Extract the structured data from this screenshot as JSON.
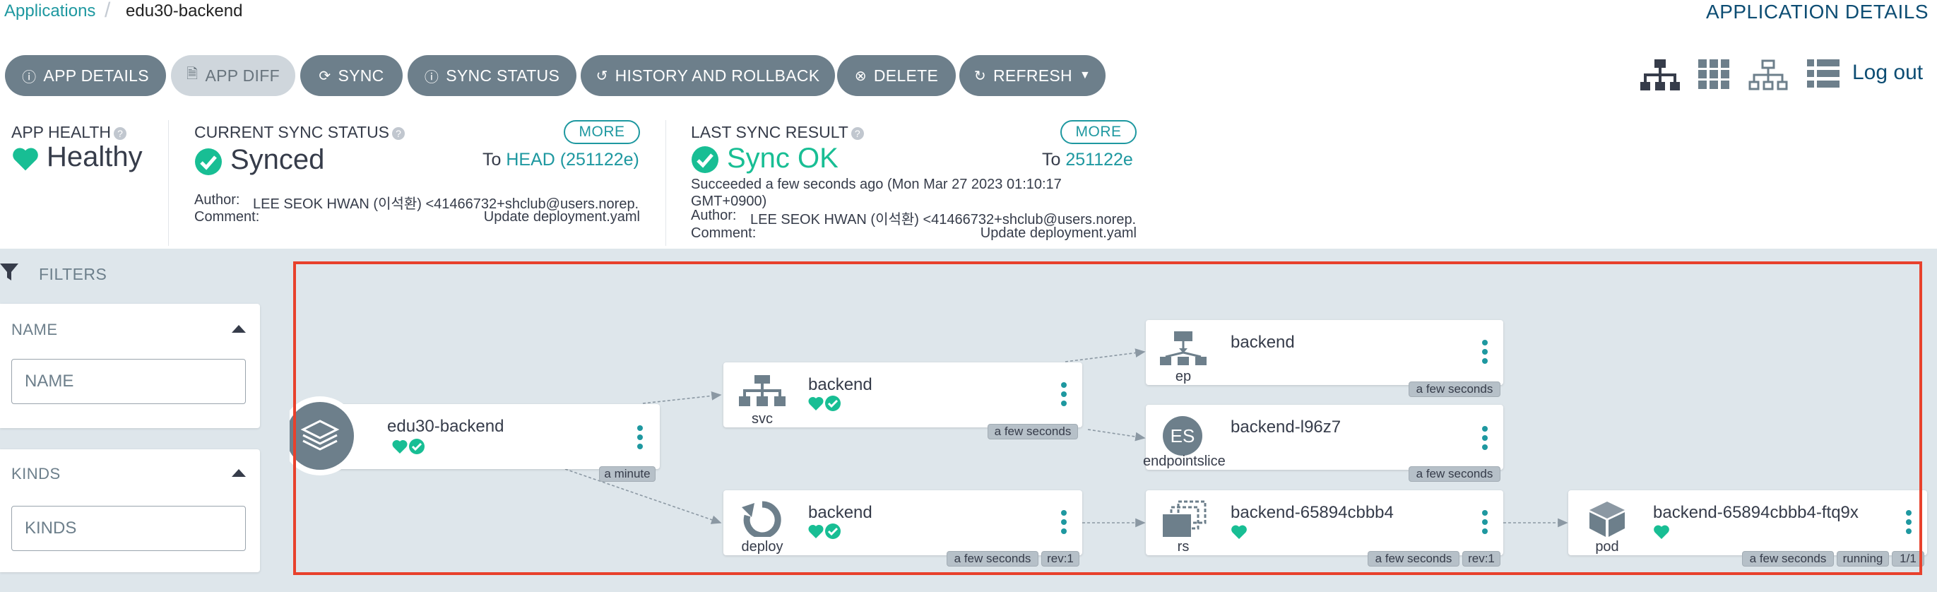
{
  "breadcrumb": {
    "applications": "Applications",
    "separator": "/",
    "current": "edu30-backend"
  },
  "page_title": "APPLICATION DETAILS",
  "toolbar": {
    "buttons": [
      {
        "label": "APP DETAILS",
        "icon": "info-icon"
      },
      {
        "label": "APP DIFF",
        "icon": "file-diff-icon",
        "disabled": true
      },
      {
        "label": "SYNC",
        "icon": "sync-icon"
      },
      {
        "label": "SYNC STATUS",
        "icon": "info-icon"
      },
      {
        "label": "HISTORY AND ROLLBACK",
        "icon": "history-icon"
      },
      {
        "label": "DELETE",
        "icon": "times-circle-icon"
      },
      {
        "label": "REFRESH",
        "icon": "redo-icon",
        "has_dropdown": true
      }
    ],
    "views": [
      "tree-view-icon",
      "pods-view-icon",
      "network-view-icon",
      "list-view-icon"
    ],
    "logout": "Log out"
  },
  "status": {
    "app_health": {
      "label": "APP HEALTH",
      "value": "Healthy",
      "color": "#18be94"
    },
    "current_sync": {
      "label": "CURRENT SYNC STATUS",
      "value": "Synced",
      "more": "MORE",
      "to_prefix": "To",
      "revision": "HEAD (251122e)",
      "author_label": "Author:",
      "author": "LEE SEOK HWAN (이석환) <41466732+shclub@users.norep...",
      "comment_label": "Comment:",
      "comment": "Update deployment.yaml"
    },
    "last_sync": {
      "label": "LAST SYNC RESULT",
      "value": "Sync OK",
      "more": "MORE",
      "to_prefix": "To",
      "revision": "251122e",
      "succeeded": "Succeeded a few seconds ago (Mon Mar 27 2023 01:10:17 GMT+0900)",
      "author_label": "Author:",
      "author": "LEE SEOK HWAN (이석환) <41466732+shclub@users.norep...",
      "comment_label": "Comment:",
      "comment": "Update deployment.yaml"
    }
  },
  "filters": {
    "title": "FILTERS",
    "name": {
      "title": "NAME",
      "placeholder": "NAME"
    },
    "kinds": {
      "title": "KINDS",
      "placeholder": "KINDS"
    }
  },
  "graph": {
    "nodes": {
      "app": {
        "name": "edu30-backend",
        "tags": [
          "a minute"
        ]
      },
      "svc": {
        "name": "backend",
        "kind": "svc",
        "tags": [
          "a few seconds"
        ]
      },
      "ep": {
        "name": "backend",
        "kind": "ep",
        "tags": [
          "a few seconds"
        ]
      },
      "eps": {
        "name": "backend-l96z7",
        "kind": "endpointslice",
        "icon_text": "ES",
        "tags": [
          "a few seconds"
        ]
      },
      "deploy": {
        "name": "backend",
        "kind": "deploy",
        "tags": [
          "a few seconds",
          "rev:1"
        ]
      },
      "rs": {
        "name": "backend-65894cbbb4",
        "kind": "rs",
        "tags": [
          "a few seconds",
          "rev:1"
        ]
      },
      "pod": {
        "name": "backend-65894cbbb4-ftq9x",
        "kind": "pod",
        "tags": [
          "a few seconds",
          "running",
          "1/1"
        ]
      }
    }
  },
  "colors": {
    "accent": "#1e98a0",
    "healthy": "#18be94",
    "button": "#6d7f8b",
    "highlight": "#e8412c"
  }
}
